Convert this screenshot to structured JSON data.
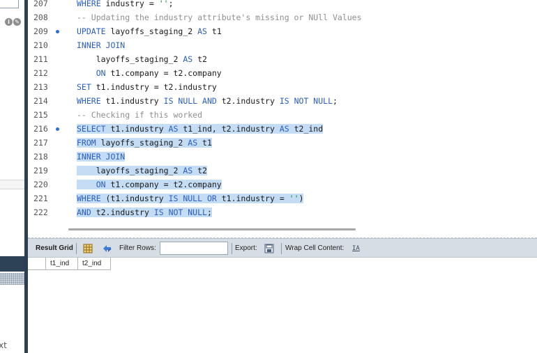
{
  "left_panel": {
    "cut_text": "xt"
  },
  "editor": {
    "lines": [
      {
        "num": "207",
        "dot": false,
        "hl": false,
        "tokens": [
          [
            "kw",
            "WHERE"
          ],
          [
            "t",
            " industry = "
          ],
          [
            "str",
            "''"
          ],
          [
            "t",
            ";"
          ]
        ]
      },
      {
        "num": "208",
        "dot": false,
        "hl": false,
        "tokens": [
          [
            "cm",
            "-- Updating the industry attribute's missing or NUll Values"
          ]
        ]
      },
      {
        "num": "209",
        "dot": true,
        "hl": false,
        "tokens": [
          [
            "kw",
            "UPDATE"
          ],
          [
            "t",
            " layoffs_staging_2 "
          ],
          [
            "kw",
            "AS"
          ],
          [
            "t",
            " t1"
          ]
        ]
      },
      {
        "num": "210",
        "dot": false,
        "hl": false,
        "tokens": [
          [
            "kw",
            "INNER JOIN"
          ]
        ]
      },
      {
        "num": "211",
        "dot": false,
        "hl": false,
        "tokens": [
          [
            "t",
            "    layoffs_staging_2 "
          ],
          [
            "kw",
            "AS"
          ],
          [
            "t",
            " t2"
          ]
        ]
      },
      {
        "num": "212",
        "dot": false,
        "hl": false,
        "tokens": [
          [
            "t",
            "    "
          ],
          [
            "kw",
            "ON"
          ],
          [
            "t",
            " t1.company = t2.company"
          ]
        ]
      },
      {
        "num": "213",
        "dot": false,
        "hl": false,
        "tokens": [
          [
            "kw",
            "SET"
          ],
          [
            "t",
            " t1.industry = t2.industry"
          ]
        ]
      },
      {
        "num": "214",
        "dot": false,
        "hl": false,
        "tokens": [
          [
            "kw",
            "WHERE"
          ],
          [
            "t",
            " t1.industry "
          ],
          [
            "kw",
            "IS NULL AND"
          ],
          [
            "t",
            " t2.industry "
          ],
          [
            "kw",
            "IS NOT NULL"
          ],
          [
            "t",
            ";"
          ]
        ]
      },
      {
        "num": "215",
        "dot": false,
        "hl": false,
        "tokens": [
          [
            "cm",
            "-- Checking if this worked"
          ]
        ]
      },
      {
        "num": "216",
        "dot": true,
        "hl": true,
        "tokens": [
          [
            "kw",
            "SELECT"
          ],
          [
            "t",
            " t1.industry "
          ],
          [
            "kw",
            "AS"
          ],
          [
            "t",
            " t1_ind, t2.industry "
          ],
          [
            "kw",
            "AS"
          ],
          [
            "t",
            " t2_ind"
          ]
        ]
      },
      {
        "num": "217",
        "dot": false,
        "hl": true,
        "tokens": [
          [
            "kw",
            "FROM"
          ],
          [
            "t",
            " layoffs_staging_2 "
          ],
          [
            "kw",
            "AS"
          ],
          [
            "t",
            " t1"
          ]
        ]
      },
      {
        "num": "218",
        "dot": false,
        "hl": true,
        "tokens": [
          [
            "kw",
            "INNER JOIN"
          ]
        ]
      },
      {
        "num": "219",
        "dot": false,
        "hl": true,
        "tokens": [
          [
            "t",
            "    layoffs_staging_2 "
          ],
          [
            "kw",
            "AS"
          ],
          [
            "t",
            " t2"
          ]
        ]
      },
      {
        "num": "220",
        "dot": false,
        "hl": true,
        "tokens": [
          [
            "t",
            "    "
          ],
          [
            "kw",
            "ON"
          ],
          [
            "t",
            " t1.company = t2.company"
          ]
        ]
      },
      {
        "num": "221",
        "dot": false,
        "hl": true,
        "tokens": [
          [
            "kw",
            "WHERE"
          ],
          [
            "t",
            " (t1.industry "
          ],
          [
            "kw",
            "IS NULL OR"
          ],
          [
            "t",
            " t1.industry = "
          ],
          [
            "str",
            "''"
          ],
          [
            "t",
            ")"
          ]
        ]
      },
      {
        "num": "222",
        "dot": false,
        "hl": true,
        "tokens": [
          [
            "kw",
            "AND"
          ],
          [
            "t",
            " t2.industry "
          ],
          [
            "kw",
            "IS NOT NULL"
          ],
          [
            "t",
            ";"
          ]
        ]
      }
    ]
  },
  "toolbar": {
    "result_grid_label": "Result Grid",
    "filter_rows_label": "Filter Rows:",
    "filter_value": "",
    "export_label": "Export:",
    "wrap_label": "Wrap Cell Content:",
    "wrap_icon_glyph": "IA"
  },
  "grid": {
    "columns": [
      "t1_ind",
      "t2_ind"
    ]
  },
  "colors": {
    "selection": "#c4dcf4",
    "keyword": "#2b5ec0",
    "comment": "#8f8f8f",
    "string": "#0f8d3a",
    "splitter": "#2c3e52"
  }
}
